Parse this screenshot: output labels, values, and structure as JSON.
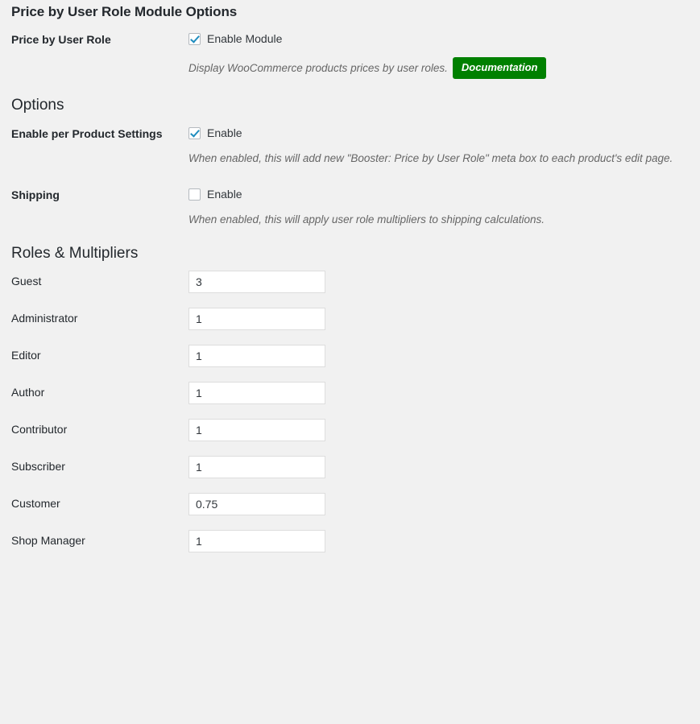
{
  "page": {
    "title": "Price by User Role Module Options"
  },
  "module": {
    "label": "Price by User Role",
    "checkbox_label": "Enable Module",
    "checked": true,
    "description": "Display WooCommerce products prices by user roles.",
    "doc_button": "Documentation",
    "doc_button_color": "#008000"
  },
  "options": {
    "heading": "Options",
    "rows": [
      {
        "label": "Enable per Product Settings",
        "checkbox_label": "Enable",
        "checked": true,
        "description": "When enabled, this will add new \"Booster: Price by User Role\" meta box to each product's edit page."
      },
      {
        "label": "Shipping",
        "checkbox_label": "Enable",
        "checked": false,
        "description": "When enabled, this will apply user role multipliers to shipping calculations."
      }
    ]
  },
  "roles": {
    "heading": "Roles & Multipliers",
    "items": [
      {
        "label": "Guest",
        "value": "3"
      },
      {
        "label": "Administrator",
        "value": "1"
      },
      {
        "label": "Editor",
        "value": "1"
      },
      {
        "label": "Author",
        "value": "1"
      },
      {
        "label": "Contributor",
        "value": "1"
      },
      {
        "label": "Subscriber",
        "value": "1"
      },
      {
        "label": "Customer",
        "value": "0.75"
      },
      {
        "label": "Shop Manager",
        "value": "1"
      }
    ]
  }
}
